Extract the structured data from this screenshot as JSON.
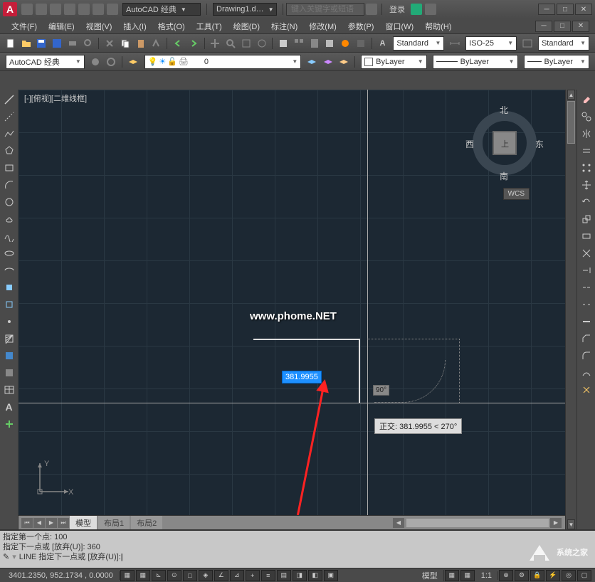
{
  "title": {
    "workspace_combo": "AutoCAD 经典",
    "document": "Drawing1.d…",
    "search_placeholder": "键入关键字或短语",
    "login": "登录"
  },
  "menu": {
    "file": "文件(F)",
    "edit": "编辑(E)",
    "view": "视图(V)",
    "insert": "插入(I)",
    "format": "格式(O)",
    "tools": "工具(T)",
    "draw": "绘图(D)",
    "dimension": "标注(N)",
    "modify": "修改(M)",
    "parametric": "参数(P)",
    "window": "窗口(W)",
    "help": "帮助(H)"
  },
  "standard_combo": "Standard",
  "iso_combo": "ISO-25",
  "standard2": "Standard",
  "workspace_combo2": "AutoCAD 经典",
  "layer_combo": "0",
  "bylayer1": "ByLayer",
  "bylayer2": "ByLayer",
  "bylayer3": "ByLayer",
  "canvas": {
    "view_label": "[-][俯视][二维线框]",
    "cube": {
      "n": "北",
      "s": "南",
      "e": "东",
      "w": "西",
      "top": "上"
    },
    "wcs": "WCS",
    "dim_value": "381.9955",
    "angle": "90°",
    "tooltip": "正交: 381.9955 < 270°",
    "watermark": "www.phome.NET",
    "ucs_x": "X",
    "ucs_y": "Y"
  },
  "tabs": {
    "model": "模型",
    "layout1": "布局1",
    "layout2": "布局2"
  },
  "cmd": {
    "l1": "指定第一个点: 100",
    "l2": "指定下一点或 [放弃(U)]: 360",
    "l3_prefix": "LINE 指定下一点或 [放弃(U)]:",
    "icon": "✎"
  },
  "status": {
    "coords": "3401.2350, 952.1734 , 0.0000",
    "model": "模型",
    "scale": "1:1"
  },
  "watermark2": "系统之家"
}
